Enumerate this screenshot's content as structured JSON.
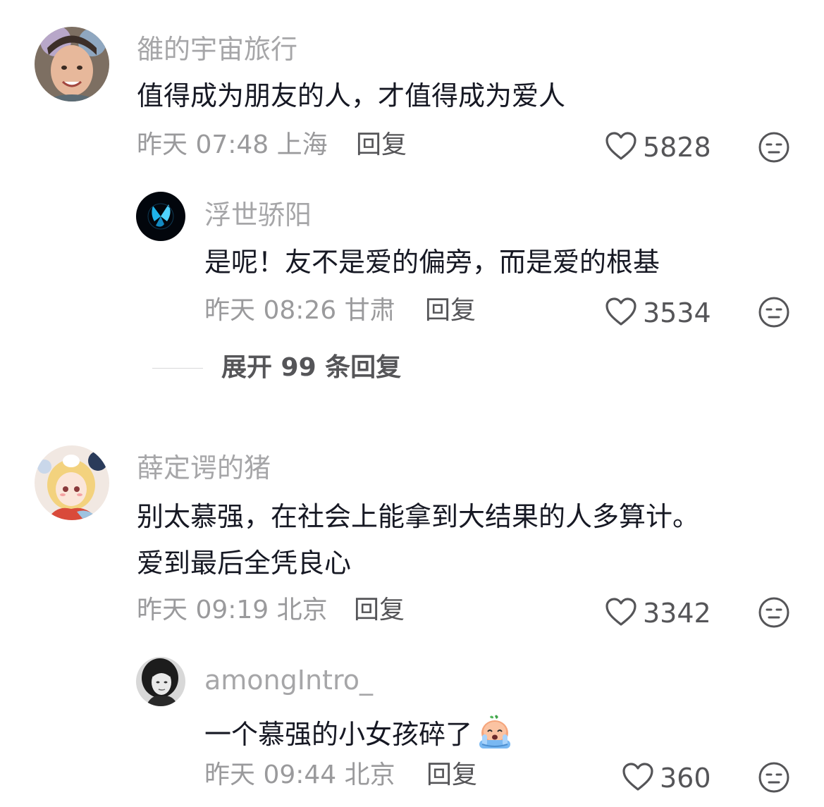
{
  "comments": [
    {
      "username": "雒的宇宙旅行",
      "content_lines": [
        "值得成为朋友的人，才值得成为爱人"
      ],
      "time": "昨天 07:48",
      "location": "上海",
      "reply_label": "回复",
      "likes": "5828",
      "replies": [
        {
          "username": "浮世骄阳",
          "content": "是呢！友不是爱的偏旁，而是爱的根基",
          "time": "昨天 08:26",
          "location": "甘肃",
          "reply_label": "回复",
          "likes": "3534"
        }
      ],
      "expand_label": "展开 99 条回复"
    },
    {
      "username": "薛定谔的猪",
      "content_lines": [
        "别太慕强，在社会上能拿到大结果的人多算计。",
        "爱到最后全凭良心"
      ],
      "time": "昨天 09:19",
      "location": "北京",
      "reply_label": "回复",
      "likes": "3342",
      "replies": [
        {
          "username": "amongIntro_",
          "content": "一个慕强的小女孩碎了",
          "time": "昨天 09:44",
          "location": "北京",
          "reply_label": "回复",
          "likes": "360"
        }
      ]
    }
  ],
  "icons": {
    "like": "heart-outline-icon",
    "dislike": "unamused-face-icon",
    "emoji": "crying-face-emoji"
  },
  "colors": {
    "username": "#a6a6a8",
    "content": "#161823",
    "meta": "#9a9a9c",
    "action": "#555558"
  }
}
